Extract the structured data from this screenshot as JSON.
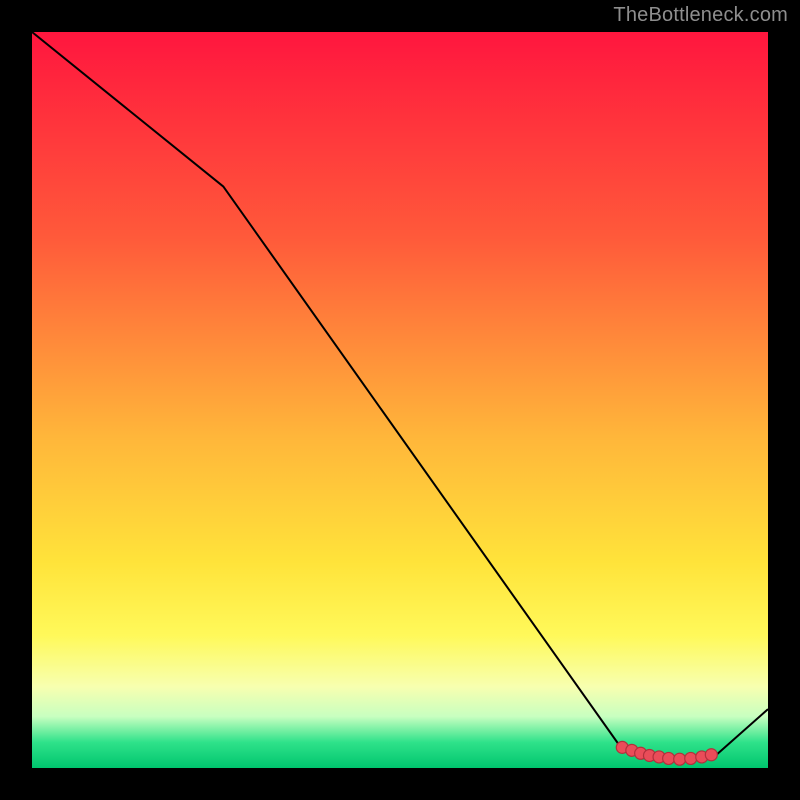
{
  "attribution": "TheBottleneck.com",
  "chart_data": {
    "type": "line",
    "title": "",
    "xlabel": "",
    "ylabel": "",
    "xlim": [
      0,
      100
    ],
    "ylim": [
      0,
      100
    ],
    "gradient_stops": [
      {
        "offset": 0,
        "color": "#ff163e"
      },
      {
        "offset": 28,
        "color": "#ff5a3a"
      },
      {
        "offset": 55,
        "color": "#ffb63a"
      },
      {
        "offset": 72,
        "color": "#ffe33a"
      },
      {
        "offset": 82,
        "color": "#fff95a"
      },
      {
        "offset": 89,
        "color": "#f7ffb0"
      },
      {
        "offset": 93,
        "color": "#c8ffc0"
      },
      {
        "offset": 96.5,
        "color": "#2fe28a"
      },
      {
        "offset": 100,
        "color": "#00c56e"
      }
    ],
    "series": [
      {
        "name": "bottleneck-curve",
        "stroke": "#000000",
        "stroke_width": 2,
        "points": [
          {
            "x": 0.0,
            "y": 100.0
          },
          {
            "x": 26.0,
            "y": 79.0
          },
          {
            "x": 80.0,
            "y": 2.8
          },
          {
            "x": 82.5,
            "y": 1.5
          },
          {
            "x": 85.0,
            "y": 1.2
          },
          {
            "x": 90.0,
            "y": 1.2
          },
          {
            "x": 93.0,
            "y": 1.8
          },
          {
            "x": 100.0,
            "y": 8.0
          }
        ]
      }
    ],
    "markers": {
      "color": "#ea4c59",
      "stroke": "#b2303c",
      "radius": 6,
      "points": [
        {
          "x": 80.2,
          "y": 2.8
        },
        {
          "x": 81.5,
          "y": 2.4
        },
        {
          "x": 82.7,
          "y": 2.0
        },
        {
          "x": 83.9,
          "y": 1.7
        },
        {
          "x": 85.2,
          "y": 1.5
        },
        {
          "x": 86.5,
          "y": 1.3
        },
        {
          "x": 88.0,
          "y": 1.2
        },
        {
          "x": 89.5,
          "y": 1.3
        },
        {
          "x": 91.0,
          "y": 1.5
        },
        {
          "x": 92.3,
          "y": 1.8
        }
      ]
    }
  }
}
